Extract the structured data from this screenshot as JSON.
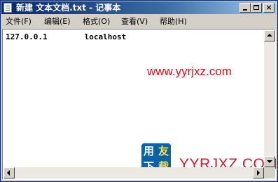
{
  "window": {
    "title": "新建 文本文档.txt - 记事本",
    "close_glyph": "×"
  },
  "menu": {
    "items": [
      {
        "label": "文件(F)"
      },
      {
        "label": "编辑(E)"
      },
      {
        "label": "格式(O)"
      },
      {
        "label": "查看(V)"
      },
      {
        "label": "帮助(H)"
      }
    ]
  },
  "editor": {
    "content": "127.0.0.1        localhost"
  },
  "watermark": {
    "url_text": "www.yyrjxz.com",
    "logo_chars": [
      "用",
      "友",
      "下",
      "载"
    ],
    "logo_text": "YYRJXZ.COM",
    "logo_color": "#0b62a7",
    "text_color": "#d51d2e"
  },
  "icons": {
    "app": "notepad-icon",
    "minimize": "minimize-icon",
    "maximize": "maximize-icon",
    "close": "close-icon"
  }
}
